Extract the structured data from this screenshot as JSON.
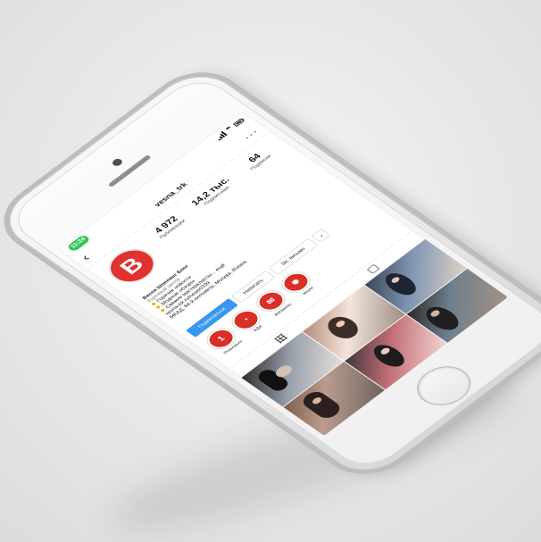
{
  "status_bar": {
    "time": "11:24"
  },
  "profile": {
    "username": "vesna_trk",
    "avatar_letter": "B",
    "stats": [
      {
        "value": "4 972",
        "label": "Публикации"
      },
      {
        "value": "14,2 тыс.",
        "label": "Подписчики"
      },
      {
        "value": "64",
        "label": "Подписки"
      }
    ],
    "bio": {
      "name": "Весна Шоппинг Блог",
      "category": "Торговый центр",
      "lines": [
        "Горячие новости",
        "Модные обзоры",
        "Свежие мастерклассы... ещё",
        "vesna-trk.ru/news0339",
        "МКАД, 84-й километр, Москва, Russia"
      ]
    },
    "actions": {
      "subscribe": "Подписаться",
      "write": "Написать",
      "email": "Эл. письмо",
      "more": "⌄"
    },
    "highlights": [
      {
        "icon_text": "1",
        "label": "Розыгрыш"
      },
      {
        "icon_text": "◔",
        "label": "ЕДА"
      },
      {
        "icon_text": "✉",
        "label": "магазины"
      },
      {
        "icon_text": "✹",
        "label": "акции"
      }
    ]
  },
  "icons": {
    "back": "‹",
    "more": "···",
    "grid": "grid-icon",
    "tagged": "tag-icon"
  }
}
